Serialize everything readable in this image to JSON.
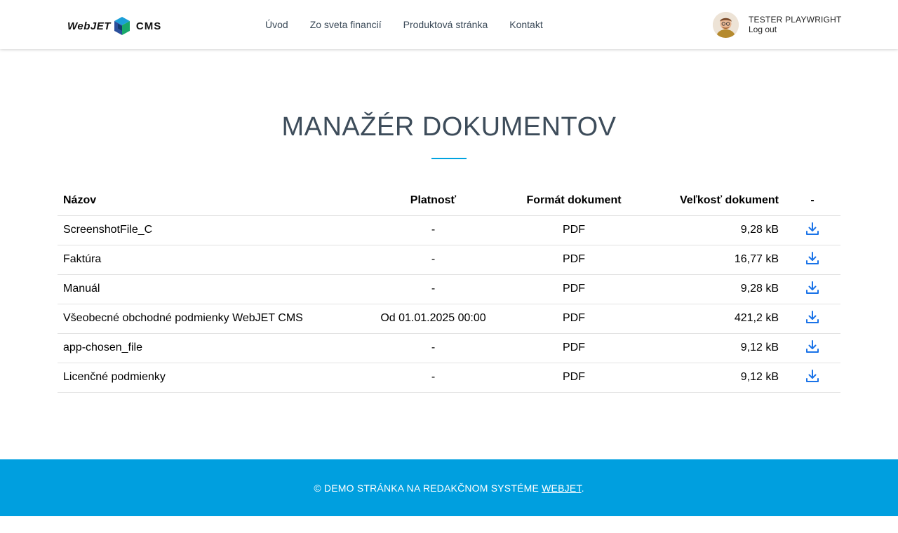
{
  "header": {
    "logo": {
      "left_text": "WebJET",
      "right_text": "CMS"
    },
    "nav": [
      {
        "label": "Úvod"
      },
      {
        "label": "Zo sveta financií"
      },
      {
        "label": "Produktová stránka"
      },
      {
        "label": "Kontakt"
      }
    ],
    "user": {
      "name": "TESTER PLAYWRIGHT",
      "logout_label": "Log out"
    }
  },
  "main": {
    "title": "MANAŽÉR DOKUMENTOV",
    "table": {
      "headers": {
        "name": "Názov",
        "validity": "Platnosť",
        "format": "Formát dokument",
        "size": "Veľkosť dokument",
        "action": "-"
      },
      "rows": [
        {
          "name": "ScreenshotFile_C",
          "validity": "-",
          "format": "PDF",
          "size": "9,28 kB",
          "action_icon": "download-icon"
        },
        {
          "name": "Faktúra",
          "validity": "-",
          "format": "PDF",
          "size": "16,77 kB",
          "action_icon": "download-icon"
        },
        {
          "name": "Manuál",
          "validity": "-",
          "format": "PDF",
          "size": "9,28 kB",
          "action_icon": "download-icon"
        },
        {
          "name": "Všeobecné obchodné podmienky WebJET CMS",
          "validity": "Od 01.01.2025 00:00",
          "format": "PDF",
          "size": "421,2 kB",
          "action_icon": "download-icon"
        },
        {
          "name": "app-chosen_file",
          "validity": "-",
          "format": "PDF",
          "size": "9,12 kB",
          "action_icon": "download-icon"
        },
        {
          "name": "Licenčné podmienky",
          "validity": "-",
          "format": "PDF",
          "size": "9,12 kB",
          "action_icon": "download-icon"
        }
      ]
    }
  },
  "footer": {
    "text_prefix": "© DEMO STRÁNKA NA REDAKČNOM SYSTÉME ",
    "link_label": "WEBJET",
    "text_suffix": "."
  },
  "colors": {
    "accent": "#00a3e0",
    "footer_bg": "#009fdf",
    "download_icon": "#1a73e8",
    "title": "#3d4c5a"
  }
}
